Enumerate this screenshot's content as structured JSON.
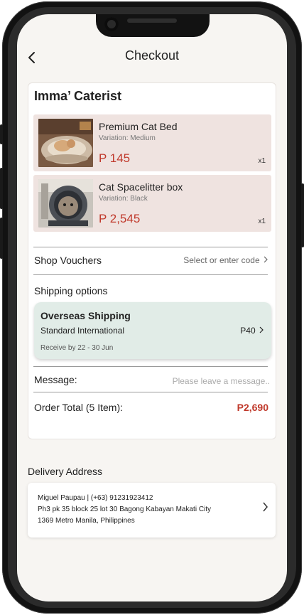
{
  "header": {
    "title": "Checkout"
  },
  "shop": {
    "name": "Imma’ Caterist",
    "items": [
      {
        "name": "Premium Cat Bed",
        "variation": "Variation: Medium",
        "price": "P 145",
        "qty": "x1"
      },
      {
        "name": "Cat Spacelitter box",
        "variation": "Variation: Black",
        "price": "P 2,545",
        "qty": "x1"
      }
    ]
  },
  "vouchers": {
    "label": "Shop Vouchers",
    "action": "Select or enter code"
  },
  "shipping": {
    "label": "Shipping options",
    "title": "Overseas Shipping",
    "method": "Standard International",
    "price": "P40",
    "receive": "Receive by 22 - 30 Jun"
  },
  "message": {
    "label": "Message:",
    "placeholder": "Please leave a message.."
  },
  "order_total": {
    "label": "Order Total (5 Item):",
    "value": "P2,690"
  },
  "delivery": {
    "title": "Delivery Address",
    "line1": "Miguel Paupau | (+63) 91231923412",
    "line2": "Ph3 pk 35 block 25 lot 30 Bagong Kabayan Makati City",
    "line3": "1369 Metro Manila, Philippines"
  },
  "colors": {
    "price": "#c0392b",
    "item_bg": "#efe3e0",
    "shipping_bg": "#e1ece7",
    "screen_bg": "#f7f5f2"
  },
  "icons": [
    "back-arrow-icon",
    "chevron-right-icon",
    "cat-bed-photo",
    "cat-litter-box-photo"
  ]
}
